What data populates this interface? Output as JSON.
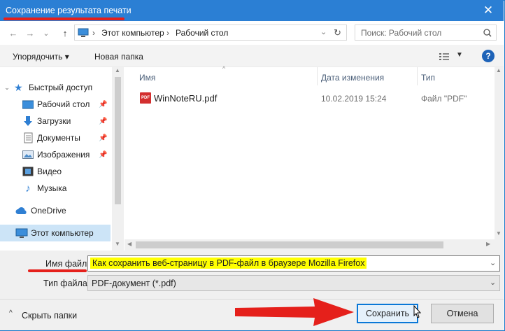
{
  "window": {
    "title": "Сохранение результата печати",
    "close_symbol": "✕"
  },
  "navigation": {
    "back": "←",
    "forward": "→",
    "recent": "⌄",
    "up": "↑",
    "breadcrumb": [
      "Этот компьютер",
      "Рабочий стол"
    ],
    "separator": "›",
    "refresh": "↻",
    "search_placeholder": "Поиск: Рабочий стол"
  },
  "toolbar": {
    "organize": "Упорядочить ▾",
    "new_folder": "Новая папка",
    "help": "?"
  },
  "sidebar": {
    "items": [
      {
        "label": "Быстрый доступ",
        "icon": "star-icon"
      },
      {
        "label": "Рабочий стол",
        "icon": "desktop-folder-icon",
        "pinned": true
      },
      {
        "label": "Загрузки",
        "icon": "download-icon",
        "pinned": true
      },
      {
        "label": "Документы",
        "icon": "documents-icon",
        "pinned": true
      },
      {
        "label": "Изображения",
        "icon": "pictures-icon",
        "pinned": true
      },
      {
        "label": "Видео",
        "icon": "video-icon"
      },
      {
        "label": "Музыка",
        "icon": "music-icon"
      },
      {
        "label": "OneDrive",
        "icon": "cloud-icon"
      },
      {
        "label": "Этот компьютер",
        "icon": "computer-icon",
        "selected": true
      }
    ]
  },
  "file_list": {
    "columns": [
      "Имя",
      "Дата изменения",
      "Тип"
    ],
    "rows": [
      {
        "name": "WinNoteRU.pdf",
        "date": "10.02.2019 15:24",
        "type": "Файл \"PDF\"",
        "icon_text": "PDF"
      }
    ]
  },
  "form": {
    "filename_label": "Имя файла:",
    "filename_value": "Как сохранить веб-страницу в PDF-файл в браузере Mozilla Firefox",
    "filetype_label": "Тип файла:",
    "filetype_value": "PDF-документ (*.pdf)"
  },
  "footer": {
    "hide_folders": "Скрыть папки",
    "save": "Сохранить",
    "cancel": "Отмена"
  },
  "colors": {
    "title_bar": "#2b7fd4",
    "highlight": "#ffff00",
    "annotation_red": "#e5201b"
  }
}
